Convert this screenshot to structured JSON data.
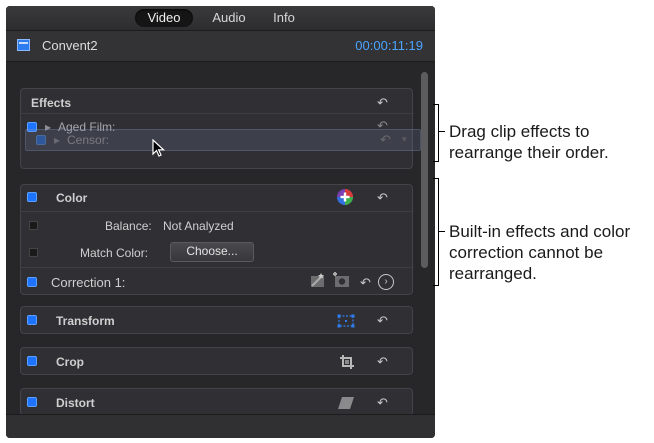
{
  "tabs": [
    {
      "label": "Video",
      "active": true
    },
    {
      "label": "Audio",
      "active": false
    },
    {
      "label": "Info",
      "active": false
    }
  ],
  "header": {
    "clip_name": "Convent2",
    "timecode": "00:00:11:19"
  },
  "effects": {
    "title": "Effects",
    "items": [
      {
        "label": "Aged Film:"
      },
      {
        "label": "Censor:"
      }
    ]
  },
  "color": {
    "title": "Color",
    "balance_label": "Balance:",
    "balance_value": "Not Analyzed",
    "match_label": "Match Color:",
    "match_button": "Choose...",
    "correction_label": "Correction 1:"
  },
  "transform": {
    "title": "Transform"
  },
  "crop": {
    "title": "Crop"
  },
  "distort": {
    "title": "Distort"
  },
  "annotations": {
    "drag_line1": "Drag clip effects to",
    "drag_line2": "rearrange their order.",
    "builtin_line1": "Built-in effects and color",
    "builtin_line2": "correction cannot be",
    "builtin_line3": "rearranged."
  },
  "icons": {
    "reset": "reset-icon",
    "add_color": "color-wheel-plus-icon",
    "transform": "transform-icon",
    "crop": "crop-icon",
    "distort": "distort-icon",
    "cursor": "arrow-cursor-icon"
  },
  "colors": {
    "accent": "#1e74ff",
    "timecode": "#4aa3ff"
  }
}
